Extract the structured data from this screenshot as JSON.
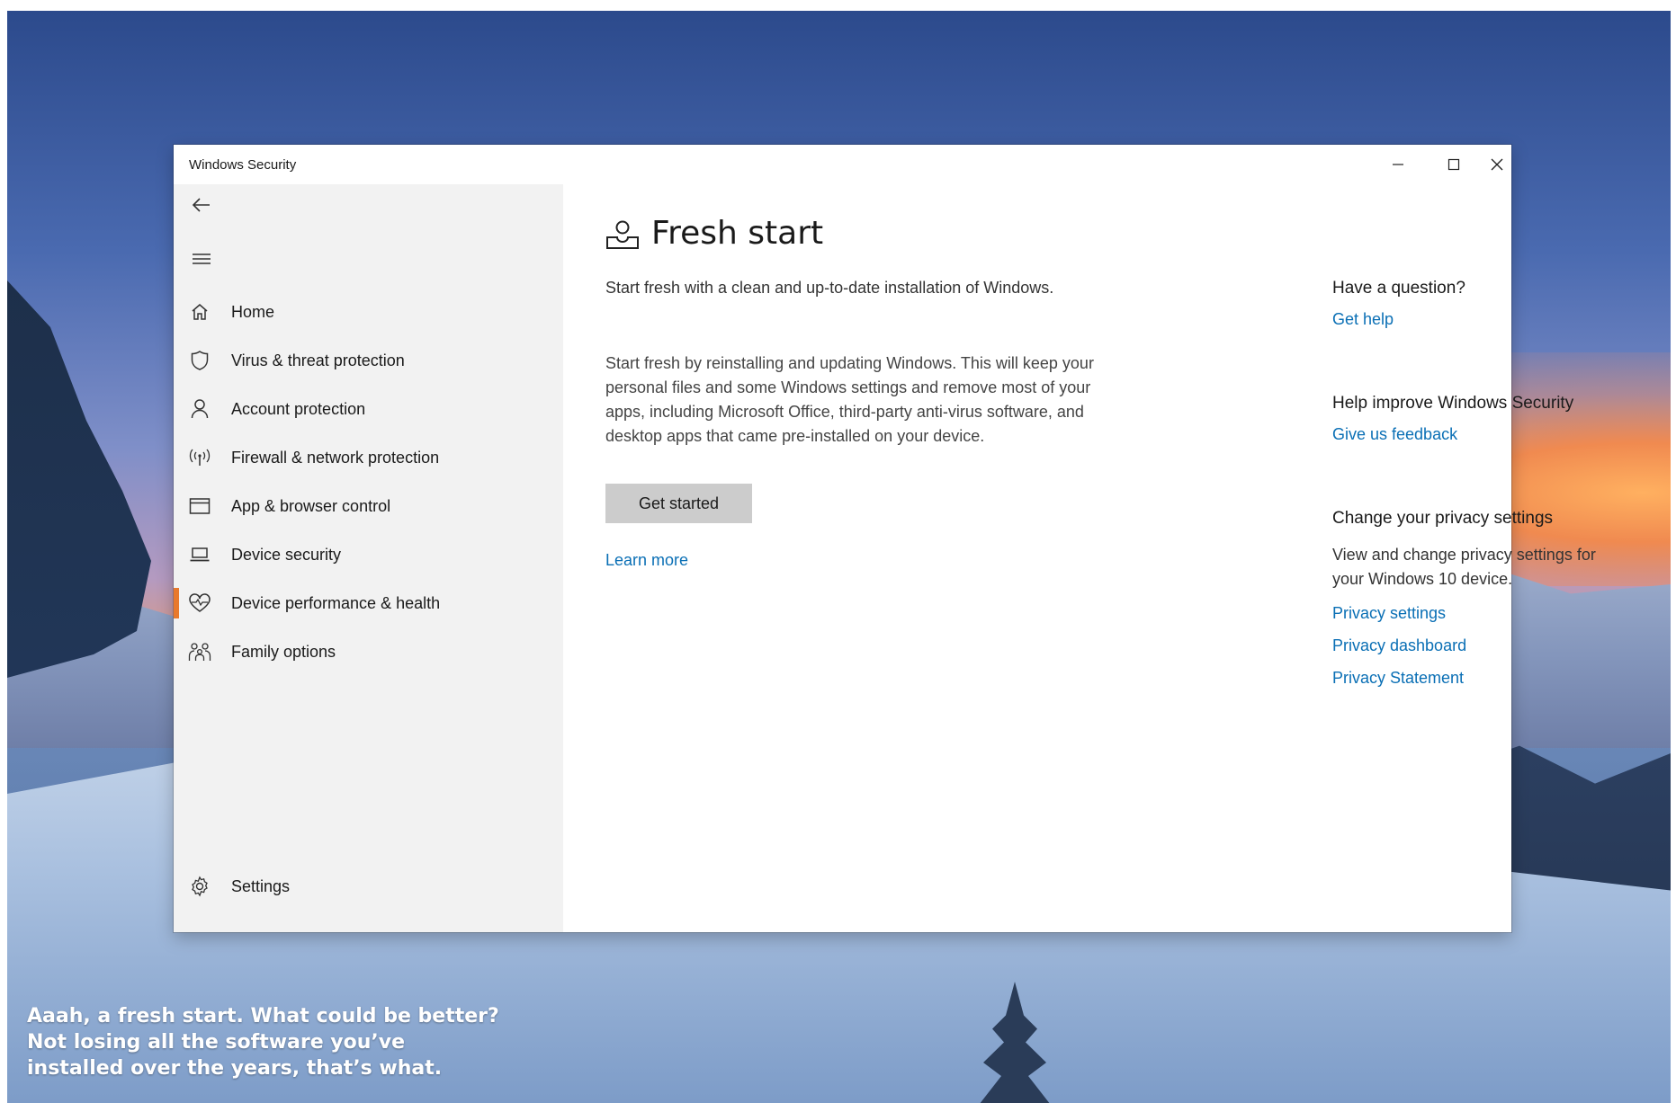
{
  "window": {
    "title": "Windows Security",
    "controls": {
      "minimize": "minimize-icon",
      "maximize": "maximize-icon",
      "close": "close-icon"
    }
  },
  "sidebar": {
    "back_icon": "back-arrow-icon",
    "menu_icon": "hamburger-menu-icon",
    "items": [
      {
        "label": "Home",
        "icon": "home-icon"
      },
      {
        "label": "Virus & threat protection",
        "icon": "shield-icon"
      },
      {
        "label": "Account protection",
        "icon": "person-icon"
      },
      {
        "label": "Firewall & network protection",
        "icon": "antenna-icon"
      },
      {
        "label": "App & browser control",
        "icon": "browser-window-icon"
      },
      {
        "label": "Device security",
        "icon": "laptop-icon"
      },
      {
        "label": "Device performance & health",
        "icon": "heart-pulse-icon",
        "active": true
      },
      {
        "label": "Family options",
        "icon": "family-icon"
      }
    ],
    "settings": {
      "label": "Settings",
      "icon": "gear-icon"
    },
    "active_color": "#e8792c"
  },
  "main": {
    "title": "Fresh start",
    "title_icon": "fresh-start-icon",
    "intro": "Start fresh with a clean and up-to-date installation of Windows.",
    "description": "Start fresh by reinstalling and updating Windows. This will keep your personal files and some Windows settings and remove most of your apps, including Microsoft Office, third-party anti-virus software, and desktop apps that came pre-installed on your device.",
    "get_started": "Get started",
    "learn_more": "Learn more"
  },
  "aside": {
    "question_heading": "Have a question?",
    "get_help": "Get help",
    "improve_heading": "Help improve Windows Security",
    "feedback": "Give us feedback",
    "privacy_heading": "Change your privacy settings",
    "privacy_text": "View and change privacy settings for your Windows 10 device.",
    "privacy_settings": "Privacy settings",
    "privacy_dashboard": "Privacy dashboard",
    "privacy_statement": "Privacy Statement"
  },
  "caption": {
    "line1": "Aaah, a fresh start. What could be better?",
    "line2": "Not losing all the software you’ve",
    "line3": "installed over the years, that’s what."
  },
  "colors": {
    "link": "#0a6fb5",
    "button": "#cccccc",
    "sidebar_bg": "#f2f2f2"
  }
}
